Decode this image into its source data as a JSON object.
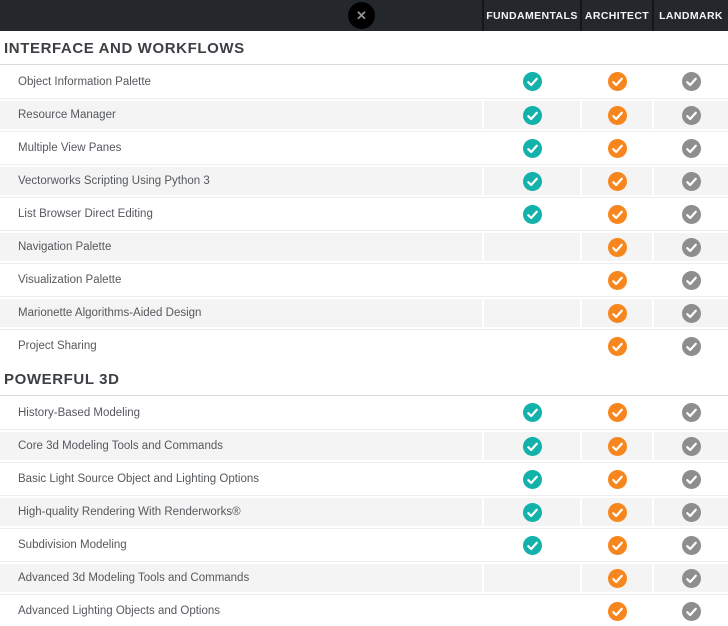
{
  "icons": {
    "close_glyph": "✕"
  },
  "colors": {
    "topbar_bg": "#24282c",
    "topbar_separator": "#141619",
    "close_button_bg": "#000000",
    "row_alt_bg": "#f4f4f4",
    "section_divider": "#d9d9d9",
    "feature_text": "#55585d",
    "section_title_text": "#3c4045"
  },
  "header": {
    "columns": [
      {
        "label": "FUNDAMENTALS",
        "check_color": "#12b2aa"
      },
      {
        "label": "ARCHITECT",
        "check_color": "#f6861d"
      },
      {
        "label": "LANDMARK",
        "check_color": "#8e8e8e"
      }
    ]
  },
  "sections": [
    {
      "title": "INTERFACE AND WORKFLOWS",
      "rows": [
        {
          "feature": "Object Information Palette",
          "availability": [
            true,
            true,
            true
          ]
        },
        {
          "feature": "Resource Manager",
          "availability": [
            true,
            true,
            true
          ]
        },
        {
          "feature": "Multiple View Panes",
          "availability": [
            true,
            true,
            true
          ]
        },
        {
          "feature": "Vectorworks Scripting Using Python 3",
          "availability": [
            true,
            true,
            true
          ]
        },
        {
          "feature": "List Browser Direct Editing",
          "availability": [
            true,
            true,
            true
          ]
        },
        {
          "feature": "Navigation Palette",
          "availability": [
            false,
            true,
            true
          ]
        },
        {
          "feature": "Visualization Palette",
          "availability": [
            false,
            true,
            true
          ]
        },
        {
          "feature": "Marionette Algorithms-Aided Design",
          "availability": [
            false,
            true,
            true
          ]
        },
        {
          "feature": "Project Sharing",
          "availability": [
            false,
            true,
            true
          ]
        }
      ]
    },
    {
      "title": "POWERFUL 3D",
      "rows": [
        {
          "feature": "History-Based Modeling",
          "availability": [
            true,
            true,
            true
          ]
        },
        {
          "feature": "Core 3d Modeling Tools and Commands",
          "availability": [
            true,
            true,
            true
          ]
        },
        {
          "feature": "Basic Light Source Object and Lighting Options",
          "availability": [
            true,
            true,
            true
          ]
        },
        {
          "feature": "High-quality Rendering With Renderworks®",
          "availability": [
            true,
            true,
            true
          ]
        },
        {
          "feature": "Subdivision Modeling",
          "availability": [
            true,
            true,
            true
          ]
        },
        {
          "feature": "Advanced 3d Modeling Tools and Commands",
          "availability": [
            false,
            true,
            true
          ]
        },
        {
          "feature": "Advanced Lighting Objects and Options",
          "availability": [
            false,
            true,
            true
          ]
        }
      ]
    }
  ]
}
